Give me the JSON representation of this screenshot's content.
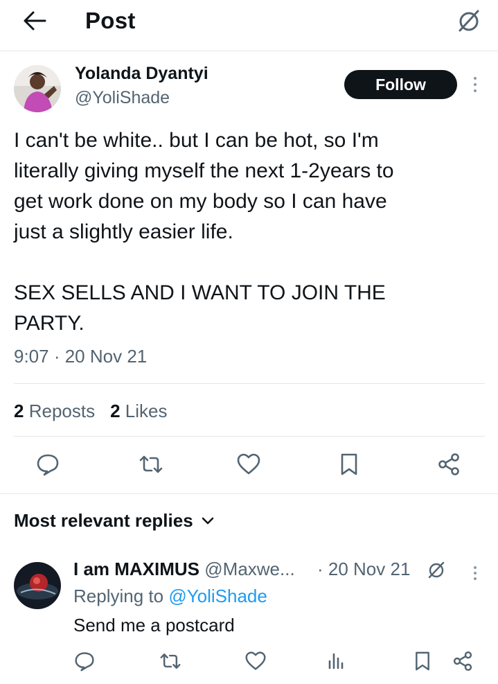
{
  "header": {
    "title": "Post",
    "back_icon": "arrow-left-icon",
    "right_icon": "slashed-circle-icon"
  },
  "post": {
    "author_name": "Yolanda Dyantyi",
    "author_handle": "@YoliShade",
    "follow_label": "Follow",
    "text": "I can't be white.. but I can be hot, so I'm\nliterally giving myself the next 1-2years to\nget work done on my body so I can have\njust a slightly easier life.\n\nSEX SELLS AND I WANT TO JOIN THE\nPARTY.",
    "timestamp": "9:07 · 20 Nov 21",
    "reposts_count": "2",
    "reposts_label": "Reposts",
    "likes_count": "2",
    "likes_label": "Likes"
  },
  "replies": {
    "header_label": "Most relevant replies",
    "items": [
      {
        "name": "I am MAXIMUS",
        "handle": "@Maxwe...",
        "date": "· 20 Nov 21",
        "replying_prefix": "Replying to ",
        "replying_handle": "@YoliShade",
        "text": "Send me a postcard"
      }
    ]
  },
  "colors": {
    "text_primary": "#0f1419",
    "text_secondary": "#536471",
    "link": "#1d9bf0",
    "divider": "#e3e6e8",
    "follow_bg": "#0f1419"
  }
}
